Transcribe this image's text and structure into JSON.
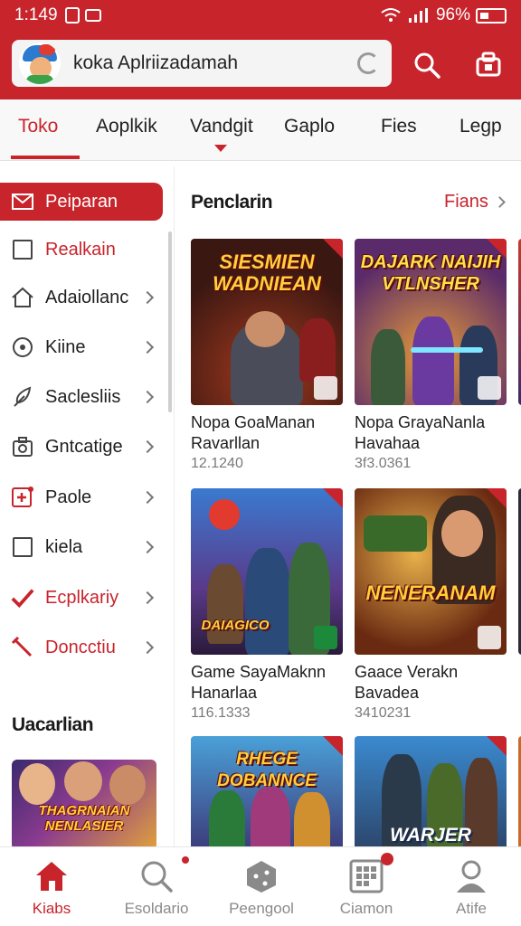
{
  "status_bar": {
    "time": "1:149",
    "battery": "96%"
  },
  "search": {
    "value": "koka Aplriizadamah"
  },
  "tabs": [
    {
      "label": "Toko",
      "active": true
    },
    {
      "label": "Aoplkik"
    },
    {
      "label": "Vandgit"
    },
    {
      "label": "Gaplo"
    },
    {
      "label": "Fies"
    },
    {
      "label": "Legp"
    }
  ],
  "sidebar": {
    "items": [
      {
        "label": "Peiparan",
        "icon": "envelope-icon",
        "active": true
      },
      {
        "label": "Realkain",
        "icon": "square-icon",
        "red": true
      },
      {
        "label": "Adaiollanc",
        "icon": "home-icon"
      },
      {
        "label": "Kiine",
        "icon": "target-icon"
      },
      {
        "label": "Saclesliis",
        "icon": "feather-icon"
      },
      {
        "label": "Gntcatige",
        "icon": "camera-icon"
      },
      {
        "label": "Paole",
        "icon": "plus-box-icon"
      },
      {
        "label": "kiela",
        "icon": "square-icon"
      },
      {
        "label": "Ecplkariy",
        "icon": "checkmark-icon",
        "red": true
      },
      {
        "label": "Doncctiu",
        "icon": "wrench-icon",
        "red": true
      }
    ],
    "section_title": "Uacarlian",
    "banner_text": "THAGRNAIAN NENLASIER"
  },
  "main": {
    "title": "Penclarin",
    "see_all": "Fians",
    "cards": [
      {
        "name": "Nopa GoaManan",
        "sub": "Ravarllan",
        "meta": "12.1240",
        "art_title": "SIESMIEN WADNIEAN"
      },
      {
        "name": "Nopa GrayaNanla",
        "sub": "Havahaa",
        "meta": "3f3.0361",
        "art_title": "DAJARK NAIJIH VTLNSHER"
      },
      {
        "name": "Game SayaMaknn",
        "sub": "Hanarlaa",
        "meta": "116.1333",
        "art_title": "DAIAGICO"
      },
      {
        "name": "Gaace Verakn",
        "sub": "Bavadea",
        "meta": "3410231",
        "art_title": "NENERANAM"
      },
      {
        "name": "",
        "sub": "",
        "meta": "",
        "art_title": "RHEGE DOBANNCE"
      },
      {
        "name": "",
        "sub": "",
        "meta": "",
        "art_title": "WARJER"
      }
    ]
  },
  "bottom_nav": [
    {
      "label": "Kiabs",
      "icon": "home-icon",
      "active": true
    },
    {
      "label": "Esoldario",
      "icon": "search-icon"
    },
    {
      "label": "Peengool",
      "icon": "dice-icon"
    },
    {
      "label": "Ciamon",
      "icon": "grid-icon"
    },
    {
      "label": "Atife",
      "icon": "person-icon"
    }
  ],
  "colors": {
    "brand": "#c8242c"
  }
}
